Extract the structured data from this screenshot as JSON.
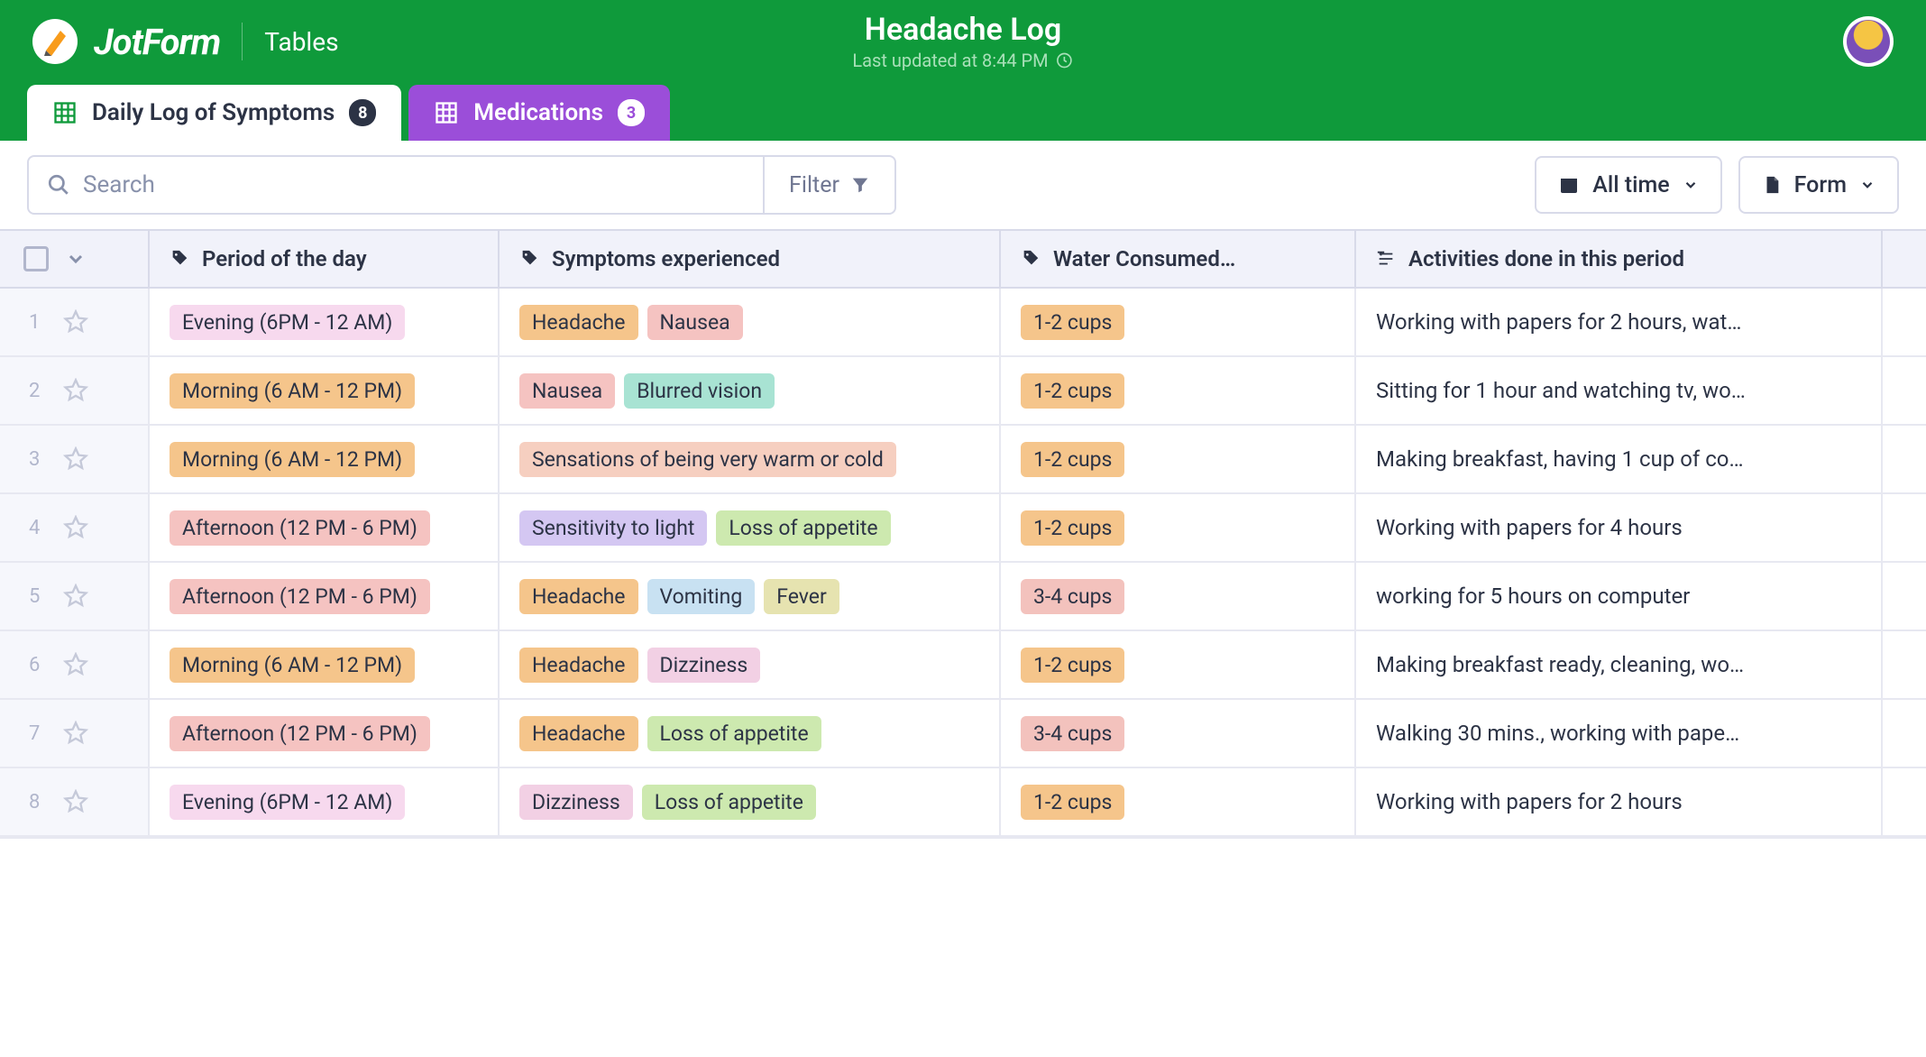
{
  "header": {
    "brand": "JotForm",
    "subproduct": "Tables",
    "title": "Headache Log",
    "subtitle": "Last updated at 8:44 PM"
  },
  "tabs": [
    {
      "label": "Daily Log of Symptoms",
      "count": "8",
      "active": true
    },
    {
      "label": "Medications",
      "count": "3",
      "active": false
    }
  ],
  "search": {
    "placeholder": "Search"
  },
  "filter": {
    "label": "Filter"
  },
  "timefilter": {
    "label": "All time"
  },
  "formbtn": {
    "label": "Form"
  },
  "columns": {
    "c1": "Period of the day",
    "c2": "Symptoms experienced",
    "c3": "Water Consumed…",
    "c4": "Activities done in this period"
  },
  "rows": [
    {
      "n": "1",
      "period": {
        "text": "Evening (6PM - 12 AM)",
        "color": "c-pink"
      },
      "symptoms": [
        {
          "text": "Headache",
          "color": "c-orange"
        },
        {
          "text": "Nausea",
          "color": "c-lightpink"
        }
      ],
      "water": {
        "text": "1-2 cups",
        "color": "c-orange"
      },
      "activities": "Working with papers for 2 hours, wat…"
    },
    {
      "n": "2",
      "period": {
        "text": "Morning (6 AM - 12 PM)",
        "color": "c-orange"
      },
      "symptoms": [
        {
          "text": "Nausea",
          "color": "c-lightpink"
        },
        {
          "text": "Blurred vision",
          "color": "c-teal"
        }
      ],
      "water": {
        "text": "1-2 cups",
        "color": "c-orange"
      },
      "activities": "Sitting for 1 hour and watching tv, wo…"
    },
    {
      "n": "3",
      "period": {
        "text": "Morning (6 AM - 12 PM)",
        "color": "c-orange"
      },
      "symptoms": [
        {
          "text": "Sensations of being very warm or cold",
          "color": "c-peach"
        }
      ],
      "water": {
        "text": "1-2 cups",
        "color": "c-orange"
      },
      "activities": "Making breakfast, having 1 cup of co…"
    },
    {
      "n": "4",
      "period": {
        "text": "Afternoon (12 PM - 6 PM)",
        "color": "c-lightpink"
      },
      "symptoms": [
        {
          "text": "Sensitivity to light",
          "color": "c-lav"
        },
        {
          "text": "Loss of appetite",
          "color": "c-lime"
        }
      ],
      "water": {
        "text": "1-2 cups",
        "color": "c-orange"
      },
      "activities": "Working with papers for 4 hours"
    },
    {
      "n": "5",
      "period": {
        "text": "Afternoon (12 PM - 6 PM)",
        "color": "c-lightpink"
      },
      "symptoms": [
        {
          "text": "Headache",
          "color": "c-orange"
        },
        {
          "text": "Vomiting",
          "color": "c-blue"
        },
        {
          "text": "Fever",
          "color": "c-khaki"
        }
      ],
      "water": {
        "text": "3-4 cups",
        "color": "c-salmon"
      },
      "activities": "working for 5 hours on computer"
    },
    {
      "n": "6",
      "period": {
        "text": "Morning (6 AM - 12 PM)",
        "color": "c-orange"
      },
      "symptoms": [
        {
          "text": "Headache",
          "color": "c-orange"
        },
        {
          "text": "Dizziness",
          "color": "c-lpink2"
        }
      ],
      "water": {
        "text": "1-2 cups",
        "color": "c-orange"
      },
      "activities": "Making breakfast ready, cleaning, wo…"
    },
    {
      "n": "7",
      "period": {
        "text": "Afternoon (12 PM - 6 PM)",
        "color": "c-lightpink"
      },
      "symptoms": [
        {
          "text": "Headache",
          "color": "c-orange"
        },
        {
          "text": "Loss of appetite",
          "color": "c-lime"
        }
      ],
      "water": {
        "text": "3-4 cups",
        "color": "c-salmon"
      },
      "activities": "Walking 30 mins., working with pape…"
    },
    {
      "n": "8",
      "period": {
        "text": "Evening (6PM - 12 AM)",
        "color": "c-pink"
      },
      "symptoms": [
        {
          "text": "Dizziness",
          "color": "c-lpink2"
        },
        {
          "text": "Loss of appetite",
          "color": "c-lime"
        }
      ],
      "water": {
        "text": "1-2 cups",
        "color": "c-orange"
      },
      "activities": "Working with papers for 2 hours"
    }
  ]
}
